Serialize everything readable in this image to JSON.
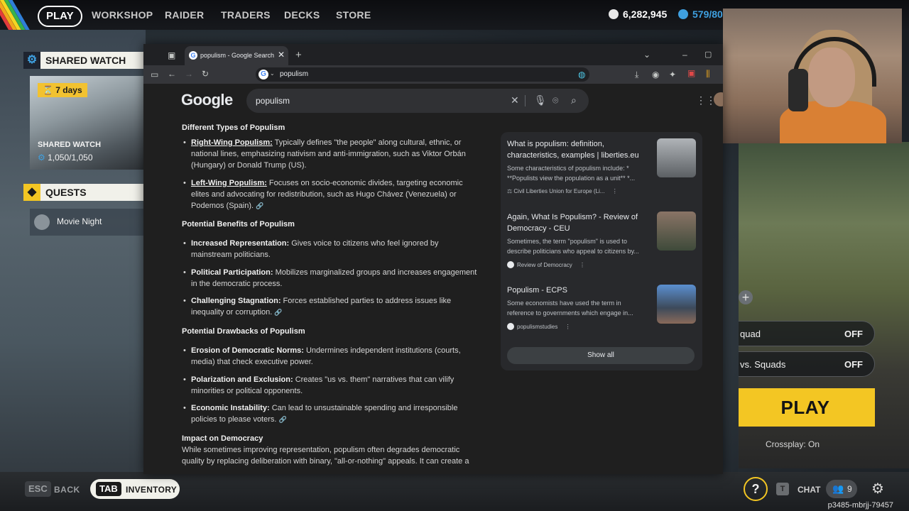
{
  "game": {
    "nav": {
      "play": "PLAY",
      "items": [
        "WORKSHOP",
        "RAIDER",
        "TRADERS",
        "DECKS",
        "STORE"
      ],
      "coins": "6,282,945",
      "credits": "579/80"
    },
    "shared_watch": {
      "header": "SHARED WATCH",
      "badge": "7 days",
      "title": "SHARED WATCH",
      "count": "1,050/1,050"
    },
    "quests": {
      "header": "QUESTS",
      "item": "Movie Night"
    },
    "right_panel": {
      "squad_label": "quad",
      "squad_value": "OFF",
      "vs_label": "vs. Squads",
      "vs_value": "OFF",
      "play": "PLAY",
      "crossplay": "Crossplay: On"
    },
    "bottom_bar": {
      "esc_key": "ESC",
      "back": "BACK",
      "tab_key": "TAB",
      "inventory": "INVENTORY",
      "chat_key": "T",
      "chat": "CHAT",
      "friends_count": "9",
      "help": "?",
      "session_id": "p3485-mbrjj-79457"
    }
  },
  "browser": {
    "tab_title": "populism - Google Search",
    "address": "populism",
    "logo": "Google",
    "search_query": "populism",
    "ai_overview": {
      "h1": "Different Types of Populism",
      "b1_bold": "Right-Wing Populism:",
      "b1_text": " Typically defines \"the people\" along cultural, ethnic, or national lines, emphasizing nativism and anti-immigration, such as Viktor Orbán (Hungary) or Donald Trump (US).",
      "b2_bold": "Left-Wing Populism:",
      "b2_text": " Focuses on socio-economic divides, targeting economic elites and advocating for redistribution, such as Hugo Chávez (Venezuela) or Podemos (Spain).",
      "h2": "Potential Benefits of Populism",
      "b3_bold": "Increased Representation:",
      "b3_text": " Gives voice to citizens who feel ignored by mainstream politicians.",
      "b4_bold": "Political Participation:",
      "b4_text": " Mobilizes marginalized groups and increases engagement in the democratic process.",
      "b5_bold": "Challenging Stagnation:",
      "b5_text": " Forces established parties to address issues like inequality or corruption.",
      "h3": "Potential Drawbacks of Populism",
      "b6_bold": "Erosion of Democratic Norms:",
      "b6_text": " Undermines independent institutions (courts, media) that check executive power.",
      "b7_bold": "Polarization and Exclusion:",
      "b7_text": " Creates \"us vs. them\" narratives that can vilify minorities or political opponents.",
      "b8_bold": "Economic Instability:",
      "b8_text": " Can lead to unsustainable spending and irresponsible policies to please voters.",
      "h4": "Impact on Democracy",
      "p1": "While sometimes improving representation, populism often degrades democratic quality by replacing deliberation with binary, \"all-or-nothing\" appeals. It can create a"
    },
    "sources": [
      {
        "title": "What is populism: definition, characteristics, examples | liberties.eu",
        "snippet": "Some characteristics of populism include: * **Populists view the population as a unit** *...",
        "site": "Civil Liberties Union for Europe (Li..."
      },
      {
        "title": "Again, What Is Populism? - Review of Democracy - CEU",
        "snippet": "Sometimes, the term \"populism\" is used to describe politicians who appeal to citizens by...",
        "site": "Review of Democracy"
      },
      {
        "title": "Populism - ECPS",
        "snippet": "Some economists have used the term in reference to governments which engage in...",
        "site": "populismstudies"
      }
    ],
    "show_all": "Show all"
  },
  "colors": {
    "accent_yellow": "#f3c623",
    "browser_bg": "#1f1f1f",
    "panel_bg": "#28292c"
  }
}
